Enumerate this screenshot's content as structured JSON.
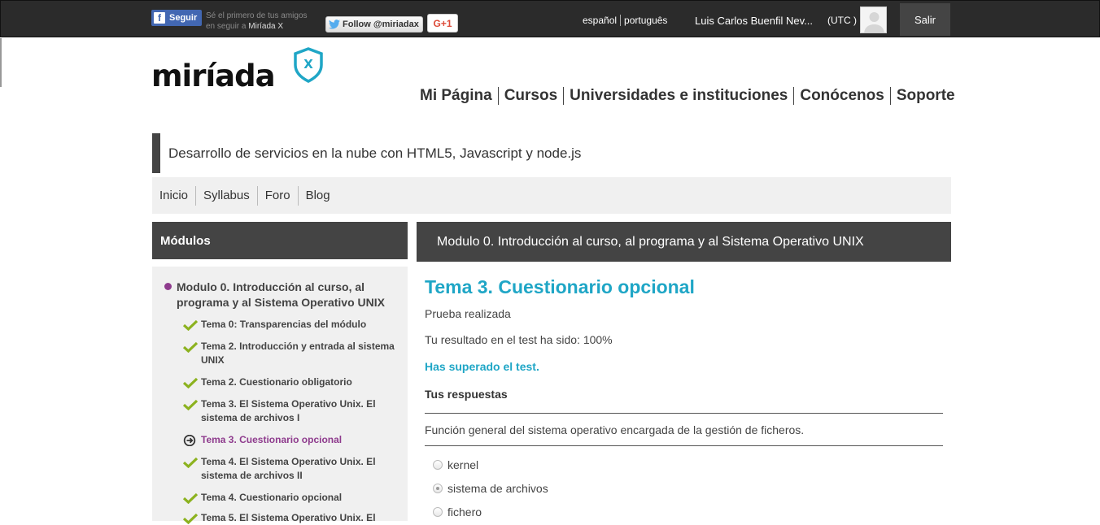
{
  "topbar": {
    "facebook_label": "Seguir",
    "facebook_text_1": "Sé el primero de tus amigos",
    "facebook_text_2": "en seguir a",
    "facebook_text_brand": "Miríada X",
    "twitter_label": "Follow @miriadax",
    "gplus_label": "G+1",
    "languages": [
      "español",
      "português"
    ],
    "user_name": "Luis Carlos Buenfil Nev...",
    "timezone": "(UTC )",
    "logout_label": "Salir"
  },
  "logo": {
    "text": "miríada",
    "badge": "X"
  },
  "main_nav": [
    "Mi Página",
    "Cursos",
    "Universidades e instituciones",
    "Conócenos",
    "Soporte"
  ],
  "course": {
    "title": "Desarrollo de servicios en la nube con HTML5, Javascript y node.js",
    "tabs": [
      "Inicio",
      "Syllabus",
      "Foro",
      "Blog"
    ]
  },
  "sidebar": {
    "header": "Módulos",
    "module_title": "Modulo 0. Introducción al curso, al programa y al Sistema Operativo UNIX",
    "lessons": [
      {
        "label": "Tema 0: Transparencias del módulo",
        "status": "done"
      },
      {
        "label": "Tema 2. Introducción y entrada al sistema UNIX",
        "status": "done"
      },
      {
        "label": "Tema 2. Cuestionario obligatorio",
        "status": "done"
      },
      {
        "label": "Tema 3. El Sistema Operativo Unix. El sistema de archivos I",
        "status": "done"
      },
      {
        "label": "Tema 3. Cuestionario opcional",
        "status": "current"
      },
      {
        "label": "Tema 4. El Sistema Operativo Unix. El sistema de archivos II",
        "status": "done"
      },
      {
        "label": "Tema 4. Cuestionario opcional",
        "status": "done"
      },
      {
        "label": "Tema 5. El Sistema Operativo Unix. El",
        "status": "done"
      }
    ]
  },
  "content": {
    "header": "Modulo 0. Introducción al curso, al programa y al Sistema Operativo UNIX",
    "lesson_title": "Tema 3. Cuestionario opcional",
    "status": "Prueba realizada",
    "result": "Tu resultado en el test ha sido: 100%",
    "passed": "Has superado el test.",
    "answers_title": "Tus respuestas",
    "question": "Función general del sistema operativo encargada de la gestión de ficheros.",
    "options": [
      {
        "label": "kernel",
        "selected": false
      },
      {
        "label": "sistema de archivos",
        "selected": true
      },
      {
        "label": "fichero",
        "selected": false
      }
    ]
  },
  "colors": {
    "accent": "#1fa6c6",
    "brand_purple": "#8e3b8d",
    "check_green": "#8cb21f",
    "dark": "#444444"
  }
}
